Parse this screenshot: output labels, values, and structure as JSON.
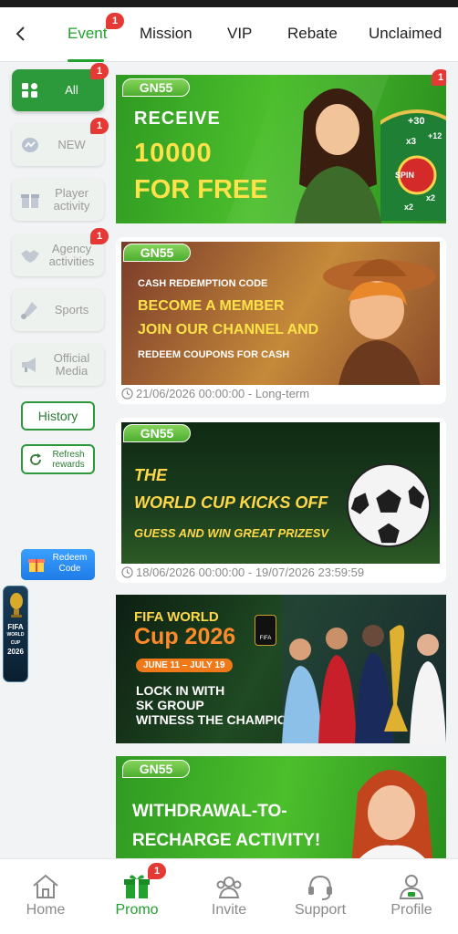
{
  "tabs": {
    "back": "back",
    "items": [
      {
        "label": "Event",
        "badge": "1"
      },
      {
        "label": "Mission"
      },
      {
        "label": "VIP"
      },
      {
        "label": "Rebate"
      },
      {
        "label": "Unclaimed"
      }
    ]
  },
  "sidebar": {
    "categories": [
      {
        "label": "All",
        "badge": "1",
        "icon": "grid-icon"
      },
      {
        "label": "NEW",
        "badge": "1",
        "icon": "messenger-icon"
      },
      {
        "label": "Player activity",
        "icon": "gift-icon"
      },
      {
        "label": "Agency activities",
        "badge": "1",
        "icon": "handshake-icon"
      },
      {
        "label": "Sports",
        "icon": "sports-icon"
      },
      {
        "label": "Official Media",
        "icon": "megaphone-icon"
      }
    ],
    "history": "History",
    "refresh": "Refresh rewards",
    "redeem": "Redeem Code"
  },
  "promos": [
    {
      "brand": "GN55",
      "badge": "1",
      "lines": [
        "RECEIVE",
        "10000",
        "FOR FREE"
      ],
      "wheel_labels": [
        "+30",
        "x3",
        "SPIN",
        "+12",
        "x2",
        "x2"
      ]
    },
    {
      "brand": "GN55",
      "lines": [
        "CASH REDEMPTION CODE",
        "BECOME A MEMBER",
        "JOIN OUR CHANNEL AND",
        "REDEEM COUPONS FOR CASH"
      ],
      "date": "21/06/2026 00:00:00 - Long-term"
    },
    {
      "brand": "GN55",
      "lines": [
        "THE",
        "WORLD CUP KICKS OFF",
        "GUESS AND WIN GREAT PRIZESV"
      ],
      "date": "18/06/2026 00:00:00 - 19/07/2026 23:59:59"
    },
    {
      "lines": [
        "FIFA WORLD",
        "Cup 2026",
        "JUNE 11 – JULY 19",
        "LOCK IN WITH",
        "SK GROUP",
        "WITNESS THE CHAMPION"
      ],
      "logo_text": "FIFA"
    },
    {
      "brand": "GN55",
      "lines": [
        "WITHDRAWAL-TO-",
        "RECHARGE ACTIVITY!"
      ]
    }
  ],
  "float_banner": {
    "lines": [
      "FIFA",
      "WORLD CUP",
      "2026"
    ]
  },
  "bottom_nav": [
    {
      "label": "Home",
      "icon": "home-icon"
    },
    {
      "label": "Promo",
      "icon": "gift-icon",
      "badge": "1",
      "active": true
    },
    {
      "label": "Invite",
      "icon": "invite-icon"
    },
    {
      "label": "Support",
      "icon": "headset-icon"
    },
    {
      "label": "Profile",
      "icon": "profile-icon"
    }
  ],
  "colors": {
    "accent": "#22a12e",
    "badge": "#e53935",
    "redeem": "#2a8ef5"
  }
}
